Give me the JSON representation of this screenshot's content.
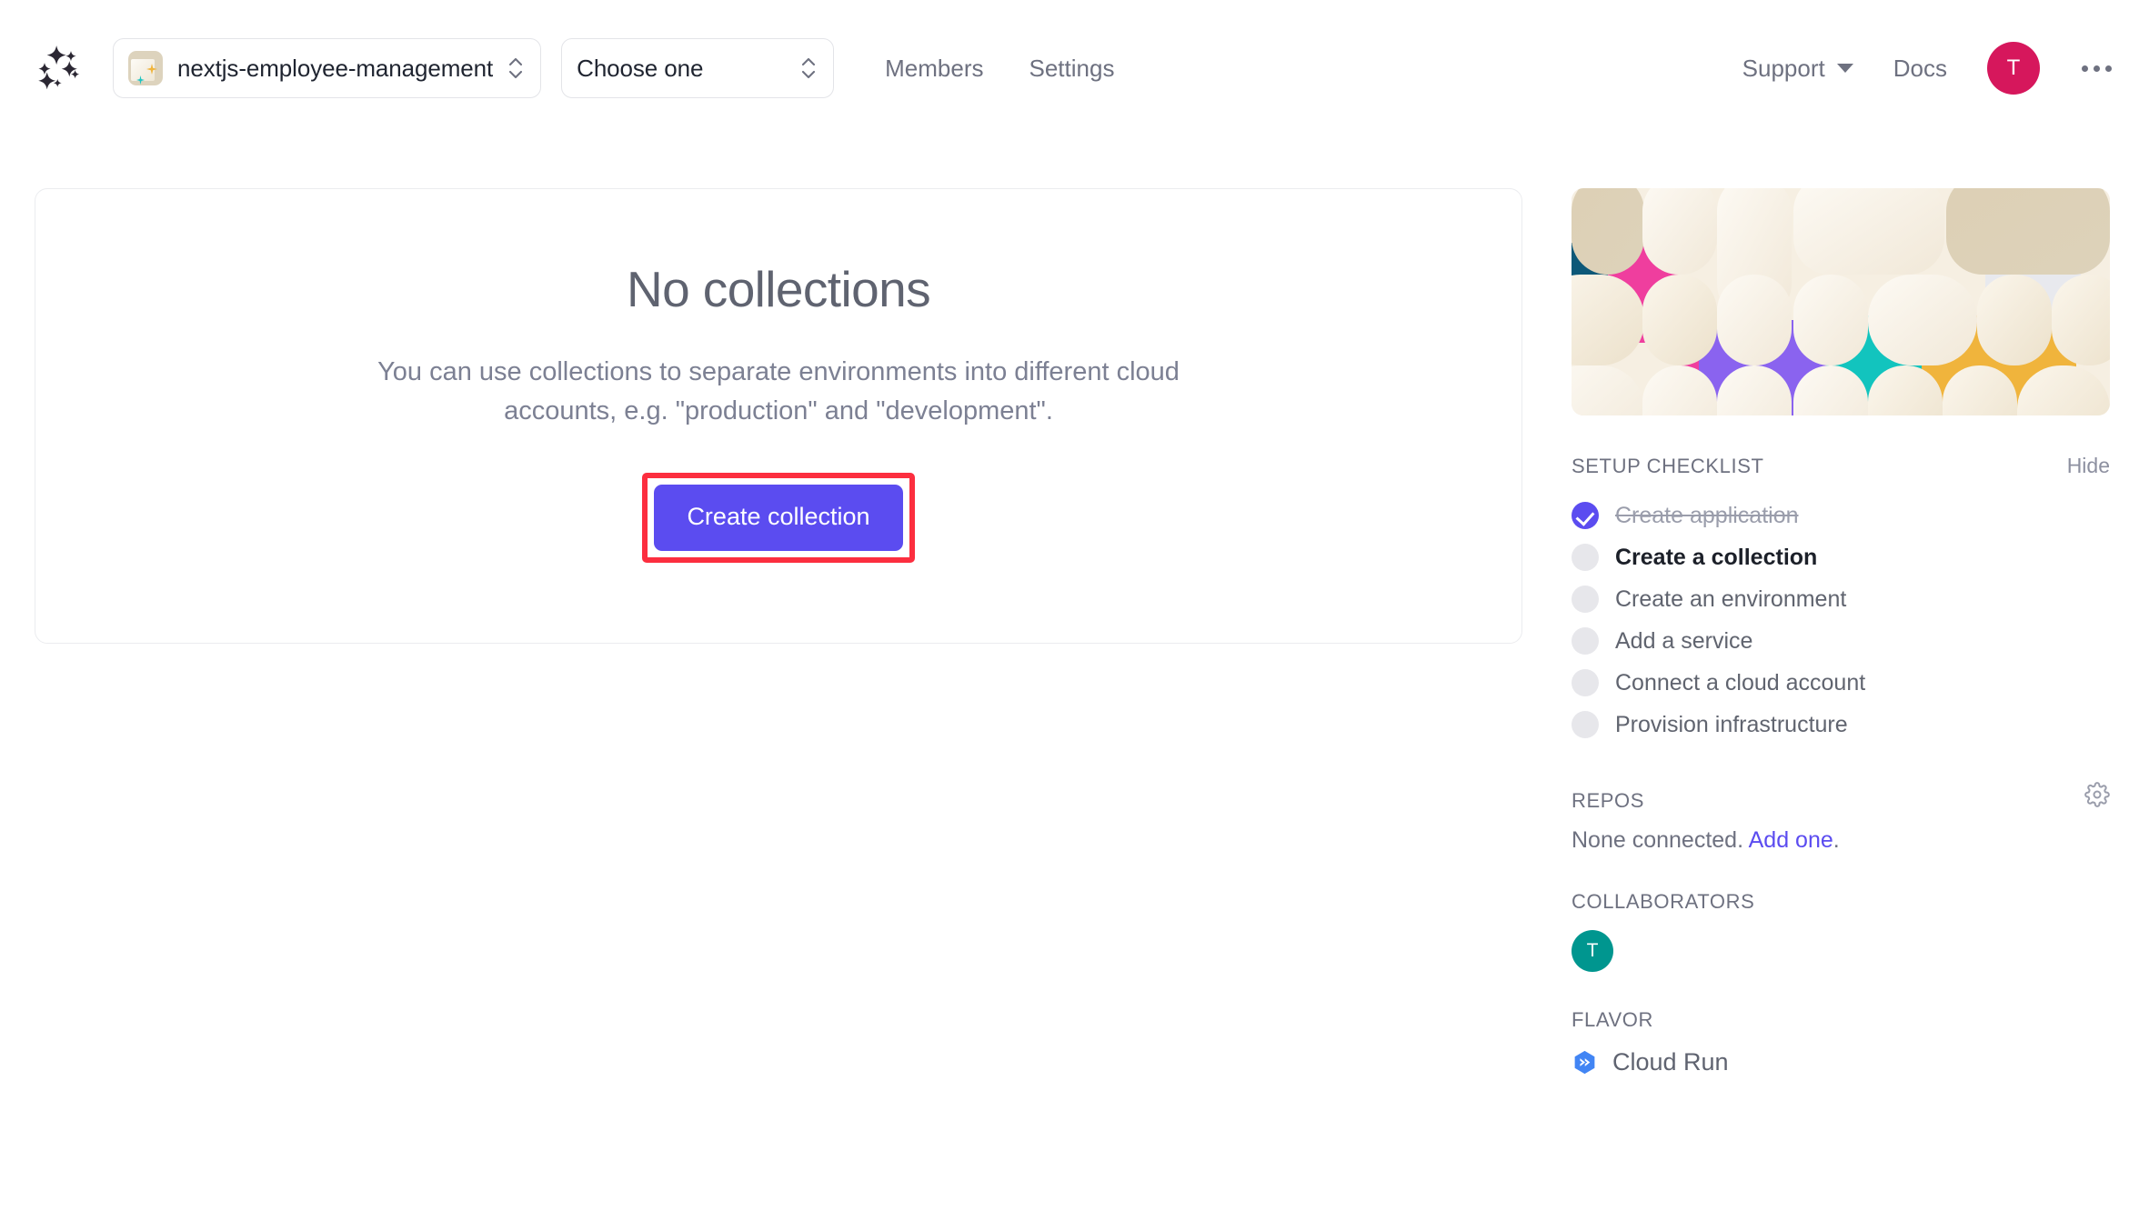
{
  "header": {
    "logo_icon": "sparkle-ring-logo",
    "app_selector": {
      "icon": "app-thumbnail-icon",
      "value": "nextjs-employee-management",
      "stepper_icon": "up-down-chevron-icon"
    },
    "env_selector": {
      "value": "Choose one",
      "stepper_icon": "up-down-chevron-icon"
    },
    "nav_left": [
      {
        "label": "Members"
      },
      {
        "label": "Settings"
      }
    ],
    "nav_right": {
      "support_label": "Support",
      "support_caret_icon": "chevron-down-icon",
      "docs_label": "Docs",
      "avatar_initial": "T",
      "avatar_color": "#d6175c",
      "overflow_icon": "ellipsis-icon"
    }
  },
  "main": {
    "empty_state": {
      "title": "No collections",
      "description": "You can use collections to separate environments into different cloud accounts, e.g. \"production\" and \"development\".",
      "cta_label": "Create collection",
      "cta_color": "#5b4cf0",
      "highlight_color": "#fc2e3f"
    }
  },
  "sidebar": {
    "banner_icon": "decorative-sparkle-pattern",
    "setup_checklist": {
      "title": "SETUP CHECKLIST",
      "hide_label": "Hide",
      "items": [
        {
          "label": "Create application",
          "state": "done"
        },
        {
          "label": "Create a collection",
          "state": "current"
        },
        {
          "label": "Create an environment",
          "state": "todo"
        },
        {
          "label": "Add a service",
          "state": "todo"
        },
        {
          "label": "Connect a cloud account",
          "state": "todo"
        },
        {
          "label": "Provision infrastructure",
          "state": "todo"
        }
      ]
    },
    "repos": {
      "title": "REPOS",
      "settings_icon": "gear-icon",
      "empty_text": "None connected.",
      "link_label": "Add one",
      "link_suffix": "."
    },
    "collaborators": {
      "title": "COLLABORATORS",
      "avatars": [
        {
          "initial": "T",
          "color": "#00968f"
        }
      ]
    },
    "flavor": {
      "title": "FLAVOR",
      "icon": "google-cloud-run-icon",
      "name": "Cloud Run"
    }
  }
}
